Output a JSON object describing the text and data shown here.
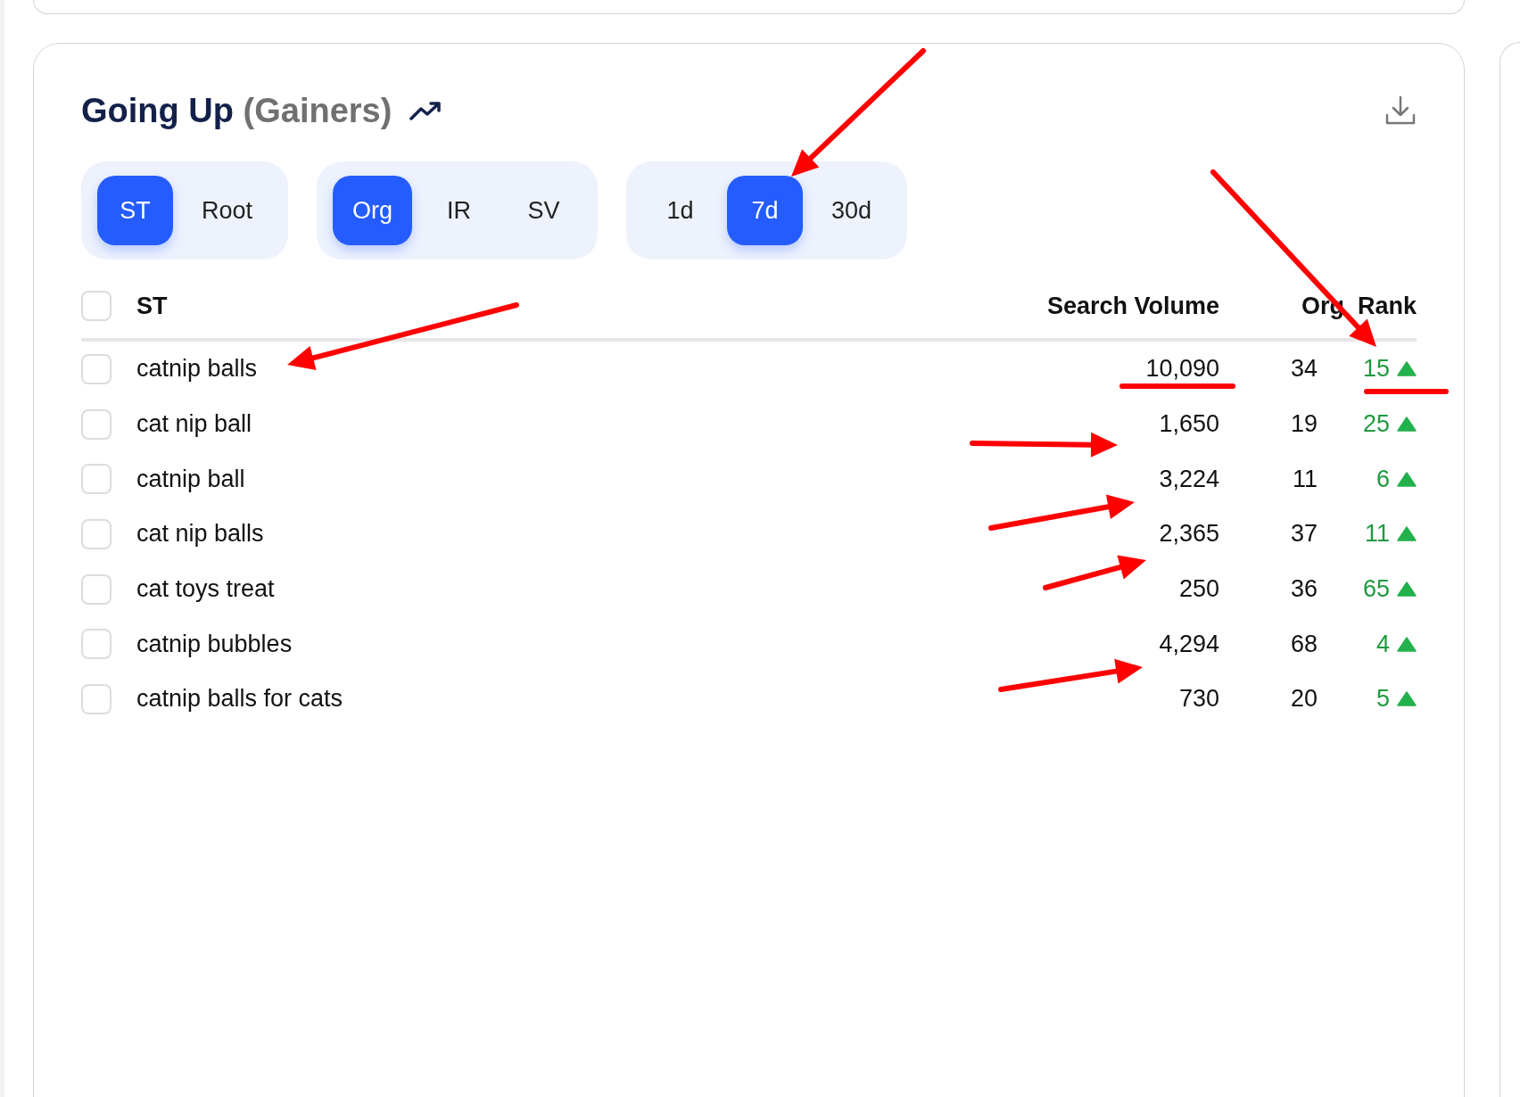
{
  "title": {
    "main": "Going Up",
    "sub": "(Gainers)"
  },
  "filter_groups": [
    {
      "options": [
        {
          "label": "ST",
          "selected": true
        },
        {
          "label": "Root",
          "selected": false
        }
      ]
    },
    {
      "options": [
        {
          "label": "Org",
          "selected": true
        },
        {
          "label": "IR",
          "selected": false
        },
        {
          "label": "SV",
          "selected": false
        }
      ]
    },
    {
      "options": [
        {
          "label": "1d",
          "selected": false
        },
        {
          "label": "7d",
          "selected": true
        },
        {
          "label": "30d",
          "selected": false
        }
      ]
    }
  ],
  "table": {
    "columns": [
      "ST",
      "Search Volume",
      "Org",
      "Rank"
    ],
    "header_checked": false,
    "rows": [
      {
        "term": "catnip balls",
        "search_volume": "10,090",
        "org": "34",
        "rank": "15",
        "rising": true,
        "checked": false
      },
      {
        "term": "cat nip ball",
        "search_volume": "1,650",
        "org": "19",
        "rank": "25",
        "rising": true,
        "checked": false
      },
      {
        "term": "catnip ball",
        "search_volume": "3,224",
        "org": "11",
        "rank": "6",
        "rising": true,
        "checked": false
      },
      {
        "term": "cat nip balls",
        "search_volume": "2,365",
        "org": "37",
        "rank": "11",
        "rising": true,
        "checked": false
      },
      {
        "term": "cat toys treat",
        "search_volume": "250",
        "org": "36",
        "rank": "65",
        "rising": true,
        "checked": false
      },
      {
        "term": "catnip bubbles",
        "search_volume": "4,294",
        "org": "68",
        "rank": "4",
        "rising": true,
        "checked": false
      },
      {
        "term": "catnip balls for cats",
        "search_volume": "730",
        "org": "20",
        "rank": "5",
        "rising": true,
        "checked": false
      }
    ]
  }
}
